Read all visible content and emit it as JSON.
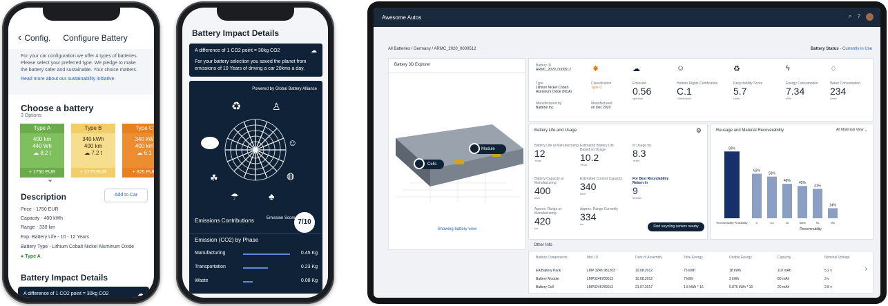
{
  "phone1": {
    "back_label": "Config.",
    "title": "Configure Battery",
    "intro_text": "For your car configuration we offer 4 types of batteries. Please select your preferred type. We pledge to make the battery safer and sustainable. Your choice matters.",
    "intro_link": "Read more about our sustainability initiative.",
    "choose_heading": "Choose a battery",
    "options_count": "3 Options",
    "cards": [
      {
        "name": "Type A",
        "l1": "400 km",
        "l2": "440 Wh",
        "l3": "8.2 t",
        "price": "+ 1750 EUR",
        "head": "#6cab4c",
        "body": "#7fbf5e",
        "text": "#ffffff"
      },
      {
        "name": "Type B",
        "l1": "340 kWh",
        "l2": "400 km",
        "l3": "7.2 t",
        "price": "+ 1275 EUR",
        "head": "#f2ce6a",
        "body": "#f7de8f",
        "text": "#3a2d10"
      },
      {
        "name": "Type C",
        "l1": "340 kW",
        "l2": "400 km",
        "l3": "6.1",
        "price": "+ 825 EUR",
        "head": "#e8801f",
        "body": "#ec8e30",
        "text": "#ffffff"
      }
    ],
    "description_heading": "Description",
    "add_to_car": "Add to Car",
    "props": [
      "Price - 1750 EUR",
      "Capacity - 400 kWh",
      "Range - 330 km",
      "Exp. Battery Life - 10 - 12 Years",
      "Battery Type - Lithium Cobalt Nickel Aluminum Oxide"
    ],
    "selected_tag": "Type A",
    "impact_heading": "Battery Impact Details",
    "impact_strip": "A difference of 1 CO2 point = 30kg CO2"
  },
  "phone2": {
    "title": "Battery Impact Details",
    "diff_line": "A difference of 1 CO2 point = 30kg CO2",
    "saved_text": "For your battery selection you saved the planet from emissions of 10 Years of driving a car 20kms a day.",
    "powered_by": "Powered by Global Battery Alliance",
    "ec_title": "Emissions Contributions",
    "score_label": "Emission Score",
    "score": "7/10",
    "phase_heading": "Emission (CO2) by Phase",
    "phases": [
      {
        "label": "Manufacturing",
        "value": "0.45 Kg",
        "fraction": 0.85
      },
      {
        "label": "Transportation",
        "value": "0.23 Kg",
        "fraction": 0.45
      },
      {
        "label": "Waste",
        "value": "0.08 Kg",
        "fraction": 0.18
      }
    ]
  },
  "dashboard": {
    "app_name": "Awesome Autos",
    "breadcrumb": "All Batteries / Germany / ARMC_2020_0000512",
    "status_label": "Battery Status",
    "status_value": "Currently in Use",
    "explorer_title": "Battery 3D Explorer",
    "module_label": "Module",
    "cells_label": "Cells",
    "explorer_caption": "Showing battery view",
    "info": {
      "battery_id_label": "Battery ID",
      "battery_id": "ARMC_2020_0000512",
      "type_label": "Type",
      "type_value": "Lithium Nickel Cobalt Aluminum Oxide (NCA)",
      "classification_label": "Classification",
      "classification_value": "Type C",
      "manufactured_by_label": "Manufactured by",
      "manufactured_by": "Batterie Inc.",
      "manufactured_label": "Manufactured",
      "manufactured": "on Dec 2020"
    },
    "kpis": [
      {
        "label": "Emission",
        "value": "0.56",
        "unit": "kg/tonne"
      },
      {
        "label": "Human Rights Certification",
        "value": "C.1",
        "unit": "Certification"
      },
      {
        "label": "Recyclability Score",
        "value": "5.7",
        "unit": "Units"
      },
      {
        "label": "Energy Consumption",
        "value": "7.34",
        "unit": "kWh"
      },
      {
        "label": "Water Consumption",
        "value": "234",
        "unit": "Litres"
      }
    ],
    "life_title": "Battery Life and Usage",
    "life_kpis": [
      {
        "label": "Battery Life at Manufacturing",
        "value": "12",
        "unit": "Years"
      },
      {
        "label": "Estimated Battery Life Based on Usage",
        "value": "10.2",
        "unit": "Years"
      },
      {
        "label": "In Usage for",
        "value": "8.3",
        "unit": "Years"
      },
      {
        "label": "Battery Capacity at Manufacturing",
        "value": "400",
        "unit": "kWh"
      },
      {
        "label": "Estimated Current Capacity",
        "value": "340",
        "unit": "kWh"
      },
      {
        "label": "For Best Recyclability Return in",
        "value": "9",
        "unit": "Months"
      },
      {
        "label": "Approx. Range at Manufacturing",
        "value": "420",
        "unit": "km"
      },
      {
        "label": "Approx. Range Currently",
        "value": "334",
        "unit": "km"
      }
    ],
    "life_button": "Find recycling centers nearby",
    "reuse_title": "Reusage and Material Recoverability",
    "reuse_select": "All Materials View",
    "other_info_title": "Other Info",
    "table_headers": [
      "Battery Components",
      "Mat. ID",
      "Date of Assembly",
      "Total Energy",
      "Usable Energy",
      "Capacity",
      "Nominal Voltage"
    ],
    "table_rows": [
      [
        "EA Battery Pack",
        "LMP 3246 981203",
        "10.08.2012",
        "75 kWh",
        "18 kWh",
        "110 mAh",
        "5.2 v"
      ],
      [
        "Battery Module",
        "LMP3246789012",
        "10.08.2012",
        "7 kWh",
        "2 kWh",
        "80 mAh",
        "3 v"
      ],
      [
        "Battery Cell",
        "LMP3246789012",
        "21.07.2017",
        "1.8 kWh * 16",
        "0.875 kWh * 16",
        "20 mAh",
        "2.8 v"
      ]
    ]
  },
  "chart_data": {
    "type": "bar",
    "title": "Reusage and Material Recoverability",
    "categories": [
      "Recoverability Probability",
      "Li",
      "Co",
      "Al",
      "Steel",
      "Ni",
      "Mn"
    ],
    "values": [
      93,
      62,
      58,
      48,
      45,
      41,
      14
    ],
    "ylim": [
      0,
      100
    ],
    "xlabel": "Recoverability",
    "colors": [
      "#15306b",
      "#8b9ec4",
      "#8b9ec4",
      "#8b9ec4",
      "#8b9ec4",
      "#8b9ec4",
      "#8b9ec4"
    ]
  }
}
